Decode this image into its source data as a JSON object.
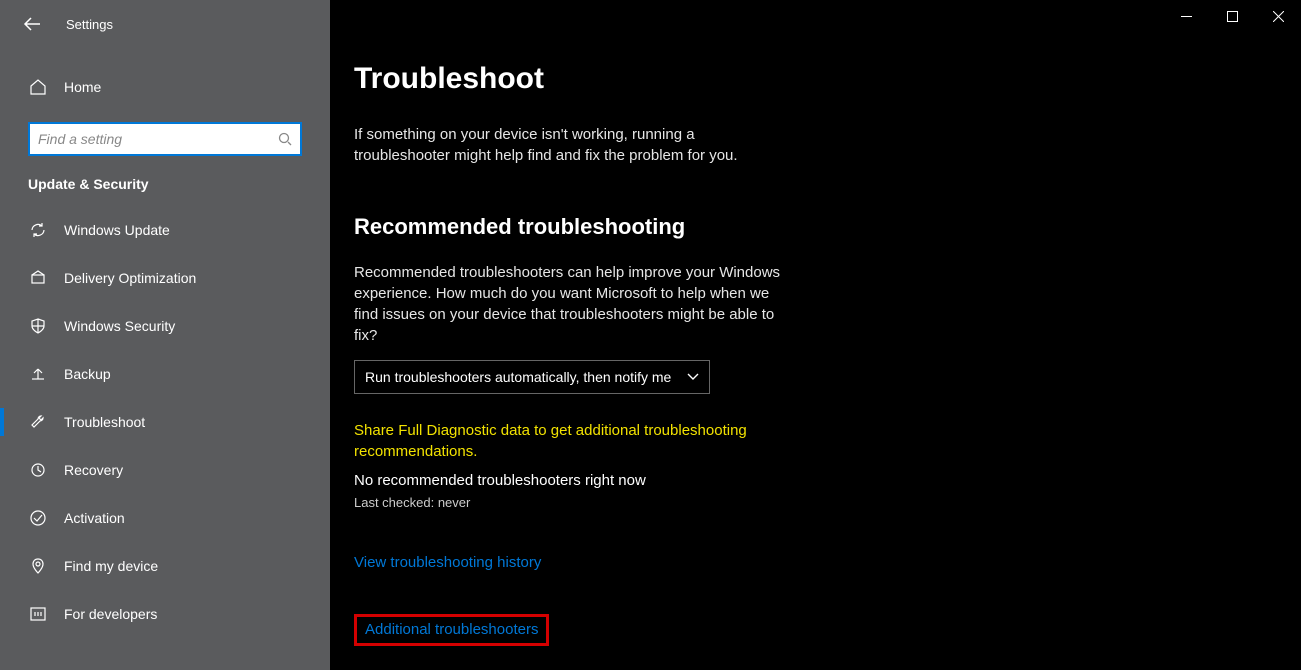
{
  "header": {
    "title": "Settings",
    "home": "Home",
    "search_placeholder": "Find a setting",
    "section": "Update & Security"
  },
  "nav": {
    "items": [
      {
        "label": "Windows Update",
        "icon": "sync"
      },
      {
        "label": "Delivery Optimization",
        "icon": "delivery"
      },
      {
        "label": "Windows Security",
        "icon": "shield"
      },
      {
        "label": "Backup",
        "icon": "backup"
      },
      {
        "label": "Troubleshoot",
        "icon": "wrench"
      },
      {
        "label": "Recovery",
        "icon": "recovery"
      },
      {
        "label": "Activation",
        "icon": "activation"
      },
      {
        "label": "Find my device",
        "icon": "location"
      },
      {
        "label": "For developers",
        "icon": "developers"
      }
    ]
  },
  "main": {
    "title": "Troubleshoot",
    "intro": "If something on your device isn't working, running a troubleshooter might help find and fix the problem for you.",
    "section_title": "Recommended troubleshooting",
    "section_desc": "Recommended troubleshooters can help improve your Windows experience. How much do you want Microsoft to help when we find issues on your device that troubleshooters might be able to fix?",
    "dropdown_value": "Run troubleshooters automatically, then notify me",
    "warning": "Share Full Diagnostic data to get additional troubleshooting recommendations.",
    "status": "No recommended troubleshooters right now",
    "last_checked": "Last checked: never",
    "link_history": "View troubleshooting history",
    "link_additional": "Additional troubleshooters"
  }
}
